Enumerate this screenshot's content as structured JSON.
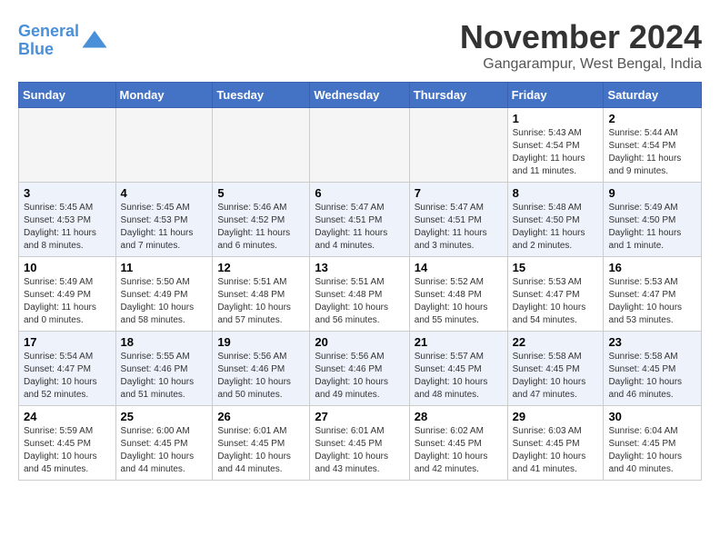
{
  "header": {
    "logo_line1": "General",
    "logo_line2": "Blue",
    "title": "November 2024",
    "subtitle": "Gangarampur, West Bengal, India"
  },
  "weekdays": [
    "Sunday",
    "Monday",
    "Tuesday",
    "Wednesday",
    "Thursday",
    "Friday",
    "Saturday"
  ],
  "weeks": [
    [
      {
        "day": "",
        "info": ""
      },
      {
        "day": "",
        "info": ""
      },
      {
        "day": "",
        "info": ""
      },
      {
        "day": "",
        "info": ""
      },
      {
        "day": "",
        "info": ""
      },
      {
        "day": "1",
        "info": "Sunrise: 5:43 AM\nSunset: 4:54 PM\nDaylight: 11 hours and 11 minutes."
      },
      {
        "day": "2",
        "info": "Sunrise: 5:44 AM\nSunset: 4:54 PM\nDaylight: 11 hours and 9 minutes."
      }
    ],
    [
      {
        "day": "3",
        "info": "Sunrise: 5:45 AM\nSunset: 4:53 PM\nDaylight: 11 hours and 8 minutes."
      },
      {
        "day": "4",
        "info": "Sunrise: 5:45 AM\nSunset: 4:53 PM\nDaylight: 11 hours and 7 minutes."
      },
      {
        "day": "5",
        "info": "Sunrise: 5:46 AM\nSunset: 4:52 PM\nDaylight: 11 hours and 6 minutes."
      },
      {
        "day": "6",
        "info": "Sunrise: 5:47 AM\nSunset: 4:51 PM\nDaylight: 11 hours and 4 minutes."
      },
      {
        "day": "7",
        "info": "Sunrise: 5:47 AM\nSunset: 4:51 PM\nDaylight: 11 hours and 3 minutes."
      },
      {
        "day": "8",
        "info": "Sunrise: 5:48 AM\nSunset: 4:50 PM\nDaylight: 11 hours and 2 minutes."
      },
      {
        "day": "9",
        "info": "Sunrise: 5:49 AM\nSunset: 4:50 PM\nDaylight: 11 hours and 1 minute."
      }
    ],
    [
      {
        "day": "10",
        "info": "Sunrise: 5:49 AM\nSunset: 4:49 PM\nDaylight: 11 hours and 0 minutes."
      },
      {
        "day": "11",
        "info": "Sunrise: 5:50 AM\nSunset: 4:49 PM\nDaylight: 10 hours and 58 minutes."
      },
      {
        "day": "12",
        "info": "Sunrise: 5:51 AM\nSunset: 4:48 PM\nDaylight: 10 hours and 57 minutes."
      },
      {
        "day": "13",
        "info": "Sunrise: 5:51 AM\nSunset: 4:48 PM\nDaylight: 10 hours and 56 minutes."
      },
      {
        "day": "14",
        "info": "Sunrise: 5:52 AM\nSunset: 4:48 PM\nDaylight: 10 hours and 55 minutes."
      },
      {
        "day": "15",
        "info": "Sunrise: 5:53 AM\nSunset: 4:47 PM\nDaylight: 10 hours and 54 minutes."
      },
      {
        "day": "16",
        "info": "Sunrise: 5:53 AM\nSunset: 4:47 PM\nDaylight: 10 hours and 53 minutes."
      }
    ],
    [
      {
        "day": "17",
        "info": "Sunrise: 5:54 AM\nSunset: 4:47 PM\nDaylight: 10 hours and 52 minutes."
      },
      {
        "day": "18",
        "info": "Sunrise: 5:55 AM\nSunset: 4:46 PM\nDaylight: 10 hours and 51 minutes."
      },
      {
        "day": "19",
        "info": "Sunrise: 5:56 AM\nSunset: 4:46 PM\nDaylight: 10 hours and 50 minutes."
      },
      {
        "day": "20",
        "info": "Sunrise: 5:56 AM\nSunset: 4:46 PM\nDaylight: 10 hours and 49 minutes."
      },
      {
        "day": "21",
        "info": "Sunrise: 5:57 AM\nSunset: 4:45 PM\nDaylight: 10 hours and 48 minutes."
      },
      {
        "day": "22",
        "info": "Sunrise: 5:58 AM\nSunset: 4:45 PM\nDaylight: 10 hours and 47 minutes."
      },
      {
        "day": "23",
        "info": "Sunrise: 5:58 AM\nSunset: 4:45 PM\nDaylight: 10 hours and 46 minutes."
      }
    ],
    [
      {
        "day": "24",
        "info": "Sunrise: 5:59 AM\nSunset: 4:45 PM\nDaylight: 10 hours and 45 minutes."
      },
      {
        "day": "25",
        "info": "Sunrise: 6:00 AM\nSunset: 4:45 PM\nDaylight: 10 hours and 44 minutes."
      },
      {
        "day": "26",
        "info": "Sunrise: 6:01 AM\nSunset: 4:45 PM\nDaylight: 10 hours and 44 minutes."
      },
      {
        "day": "27",
        "info": "Sunrise: 6:01 AM\nSunset: 4:45 PM\nDaylight: 10 hours and 43 minutes."
      },
      {
        "day": "28",
        "info": "Sunrise: 6:02 AM\nSunset: 4:45 PM\nDaylight: 10 hours and 42 minutes."
      },
      {
        "day": "29",
        "info": "Sunrise: 6:03 AM\nSunset: 4:45 PM\nDaylight: 10 hours and 41 minutes."
      },
      {
        "day": "30",
        "info": "Sunrise: 6:04 AM\nSunset: 4:45 PM\nDaylight: 10 hours and 40 minutes."
      }
    ]
  ]
}
